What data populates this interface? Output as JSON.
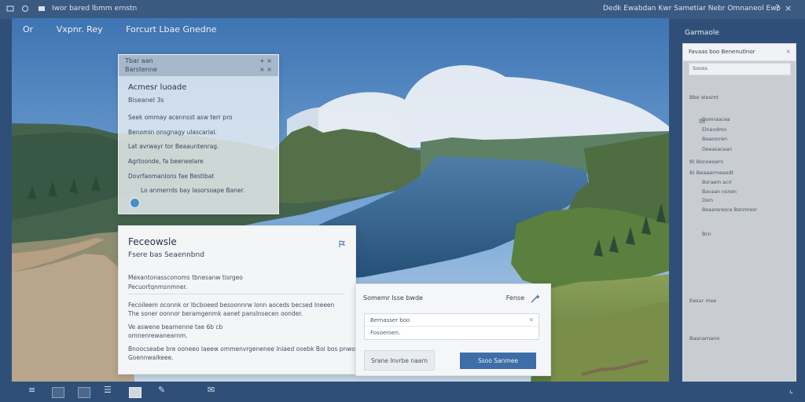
{
  "window": {
    "top_left_text": "Iwor bared lbmm ernstn",
    "top_right_text": "Dedk Ewabdan  Kwr  Sametiar Nebr Omnaneol Ewo",
    "controls": [
      "?",
      "×"
    ]
  },
  "app": {
    "title_parts": [
      "Or",
      "Vxpnr. Rey",
      "Forcurt Lbae Gnedne"
    ]
  },
  "panels": {
    "small": {
      "header_left_1": "Tbar aan",
      "header_left_2": "Barstenne",
      "header_right_1": "+ ×",
      "header_right_2": "× ×",
      "title": "Acmesr luoade",
      "subtitle": "Biseanel 3s",
      "lines": [
        "Seek ommay acennsst asw terr pro",
        "Benomin onsgnagy ulascarial.",
        "Lat avrwayr tor Beaauntenrag.",
        "Agrtoonde, fa beeneelare",
        "Dovrfaomanlons fae Bestibat",
        "Lo anmerrds bay lasorsoape Baner."
      ]
    },
    "main_dialog": {
      "title": "Feceowsle",
      "subtitle": "Fsere bas Seaennbnd",
      "paragraphs": [
        "Mexantonassconoms tbnesanw tisrgeo",
        "Pecuortqnmsnmner.",
        "Fecoileem oconnk or lbcboeed besoonnrw lonn aoceds becsed lneeen",
        "The soner oonnor beramgenmk aanet panslnsecen oonder.",
        "Ve aswene beamenne tae 6b cb",
        "omnenrewanearnm.",
        "Bnoocseabe bre ooneeo laeew ommenvrgenenee lniaed ooebk Boi bos pnwoe bed",
        "Goennwalkeee."
      ]
    },
    "side_dialog": {
      "title": "Somemr lsse bwde",
      "right_label": "Fense",
      "input_row_1": "Bernasser boo",
      "input_row_2": "Fosoeroen.",
      "chevron": "v",
      "secondary_button": "Srane lnvrbe naarn",
      "primary_button": "Ssoo Sanmee"
    }
  },
  "sidebar": {
    "title": "Garmaole",
    "header": "Favaas boo Benenutlnor",
    "close": "×",
    "search_text": "Sooss",
    "items": [
      "Bbe stesrnt",
      "Domraacea",
      "Elnandmn",
      "Beaoorren",
      "Deeasacean",
      "8) Bsnoeoern",
      "8) Beaaarmesedt",
      "Boraem acrr",
      "Bavaan nsnen",
      "Dsm",
      "Beaareresce Bsnmresr",
      "Bcn",
      "Eesur mse",
      "Basnamann"
    ]
  },
  "taskbar": {
    "icons": [
      "menu-icon",
      "window-icon",
      "gallery-icon",
      "list-icon",
      "landscape-icon",
      "pen-icon",
      "mail-icon"
    ],
    "end_icon": "corner-icon"
  },
  "colors": {
    "accent": "#3d6ea8",
    "taskbar": "#2f4f78",
    "panel": "#f4f5f7"
  }
}
